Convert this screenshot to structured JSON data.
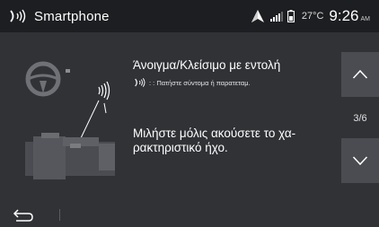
{
  "status_bar": {
    "title": "Smartphone",
    "temperature": "27°C",
    "time": "9:26",
    "ampm": "AM",
    "icons": [
      "voice-control-icon",
      "navigation-arrow-icon",
      "signal-bars-icon",
      "phone-battery-icon"
    ]
  },
  "content": {
    "heading": "Άνοιγμα/Κλείσιμο με εντολή",
    "hint": ": : Πατήστε σύντομα ή παρατεταμ.",
    "main_line1": "Μιλήστε μόλις ακούσετε το χα-",
    "main_line2": "ρακτηριστικό ήχο."
  },
  "pagination": {
    "indicator": "3/6"
  },
  "bottom_bar": {
    "back_icon": "back-arrow-icon"
  },
  "colors": {
    "background": "#303236",
    "status_bar": "#1d1e21",
    "nav_button": "#4a4c51",
    "text": "#ffffff"
  }
}
